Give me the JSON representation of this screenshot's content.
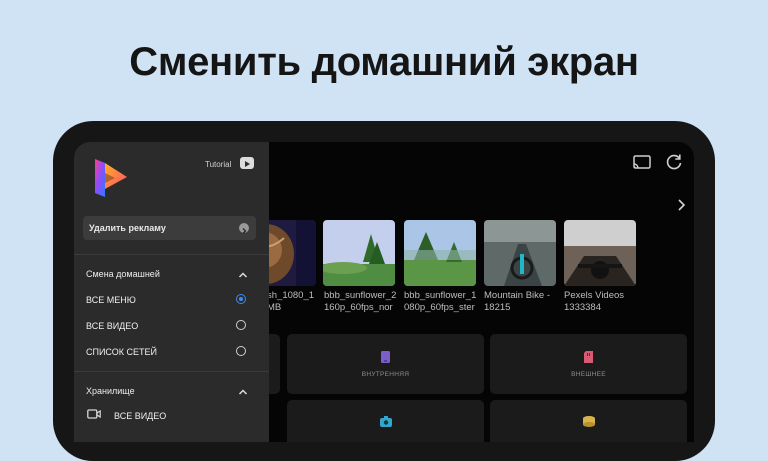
{
  "headline": "Сменить домашний экран",
  "drawer": {
    "tutorial_label": "Tutorial",
    "remove_ads_label": "Удалить рекламу",
    "home_section": {
      "title": "Смена домашней",
      "options": [
        {
          "label": "ВСЕ МЕНЮ",
          "selected": true
        },
        {
          "label": "ВСЕ ВИДЕО",
          "selected": false
        },
        {
          "label": "СПИСОК СЕТЕЙ",
          "selected": false
        }
      ]
    },
    "storage_section": {
      "title": "Хранилище",
      "items": [
        {
          "label": "ВСЕ ВИДЕО",
          "icon": "video-icon"
        }
      ]
    }
  },
  "videos": [
    {
      "label": "sh_1080_1\nMB",
      "colors": [
        "#3a2a1a",
        "#7a5030",
        "#1e1a40"
      ]
    },
    {
      "label": "bbb_sunflower_2\n160p_60fps_nor",
      "colors": [
        "#b7c6e8",
        "#3e7a3a",
        "#2d5a25"
      ]
    },
    {
      "label": "bbb_sunflower_1\n080p_60fps_ster",
      "colors": [
        "#a9c4e6",
        "#4d8a3f",
        "#2b5c26"
      ]
    },
    {
      "label": "Mountain Bike -\n18215",
      "colors": [
        "#7e8a86",
        "#3c4a4a",
        "#202424"
      ]
    },
    {
      "label": "Pexels Videos\n1333384",
      "colors": [
        "#c9c9c9",
        "#5a5048",
        "#1b1b1b"
      ]
    }
  ],
  "storage_cards": [
    {
      "label": "ВНУТРЕННЯЯ",
      "icon": "phone-icon",
      "color": "#7a5fc9"
    },
    {
      "label": "ВНЕШНЕЕ",
      "icon": "sd-card-icon",
      "color": "#d75b73"
    },
    {
      "label": "",
      "icon": "camera-icon",
      "color": "#34a6c9"
    },
    {
      "label": "",
      "icon": "storage-icon",
      "color": "#d8b24a"
    }
  ],
  "colors": {
    "background": "#cfe3f5",
    "accent": "#3d8be8"
  }
}
